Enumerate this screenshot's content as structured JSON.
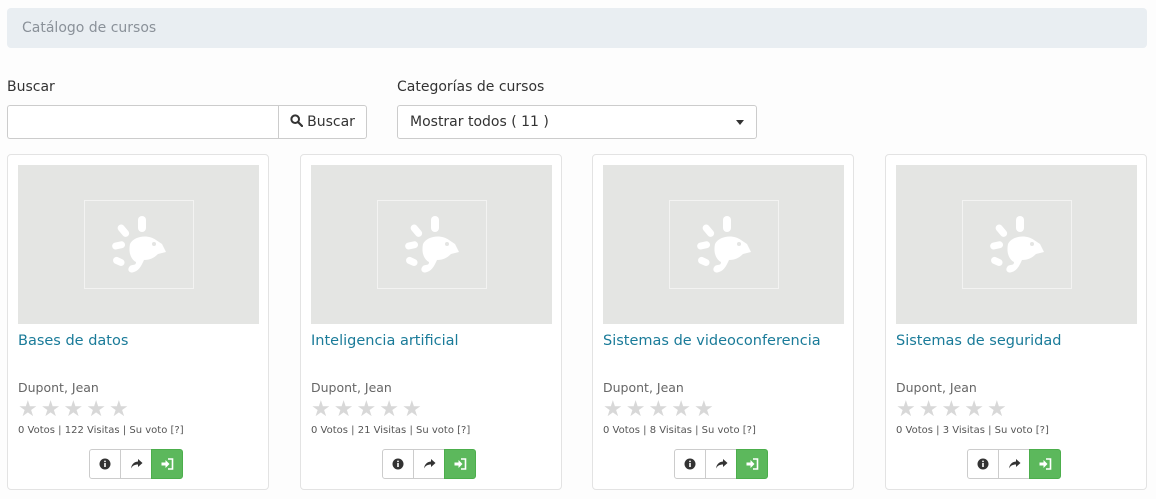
{
  "breadcrumb": {
    "label": "Catálogo de cursos"
  },
  "search": {
    "label": "Buscar",
    "value": "",
    "placeholder": "",
    "button_label": "Buscar"
  },
  "category": {
    "label": "Categorías de cursos",
    "selected": "Mostrar todos ( 11 )"
  },
  "courses": [
    {
      "title": "Bases de datos",
      "author": "Dupont, Jean",
      "votes": "0 Votos",
      "visits": "122 Visitas",
      "your_vote": "Su voto",
      "help": "[?]",
      "rating": 0
    },
    {
      "title": "Inteligencia artificial",
      "author": "Dupont, Jean",
      "votes": "0 Votos",
      "visits": "21 Visitas",
      "your_vote": "Su voto",
      "help": "[?]",
      "rating": 0
    },
    {
      "title": "Sistemas de videoconferencia",
      "author": "Dupont, Jean",
      "votes": "0 Votos",
      "visits": "8 Visitas",
      "your_vote": "Su voto",
      "help": "[?]",
      "rating": 0
    },
    {
      "title": "Sistemas de seguridad",
      "author": "Dupont, Jean",
      "votes": "0 Votos",
      "visits": "3 Visitas",
      "your_vote": "Su voto",
      "help": "[?]",
      "rating": 0
    }
  ],
  "colors": {
    "accent_link": "#1a7b99",
    "subscribe_green": "#5cb85c",
    "breadcrumb_bg": "#e9eef2"
  },
  "icons": {
    "thumbnail": "chamilo-logo-icon",
    "search": "search-icon",
    "info": "info-icon",
    "share": "share-icon",
    "subscribe": "sign-in-icon",
    "star": "star-icon"
  }
}
